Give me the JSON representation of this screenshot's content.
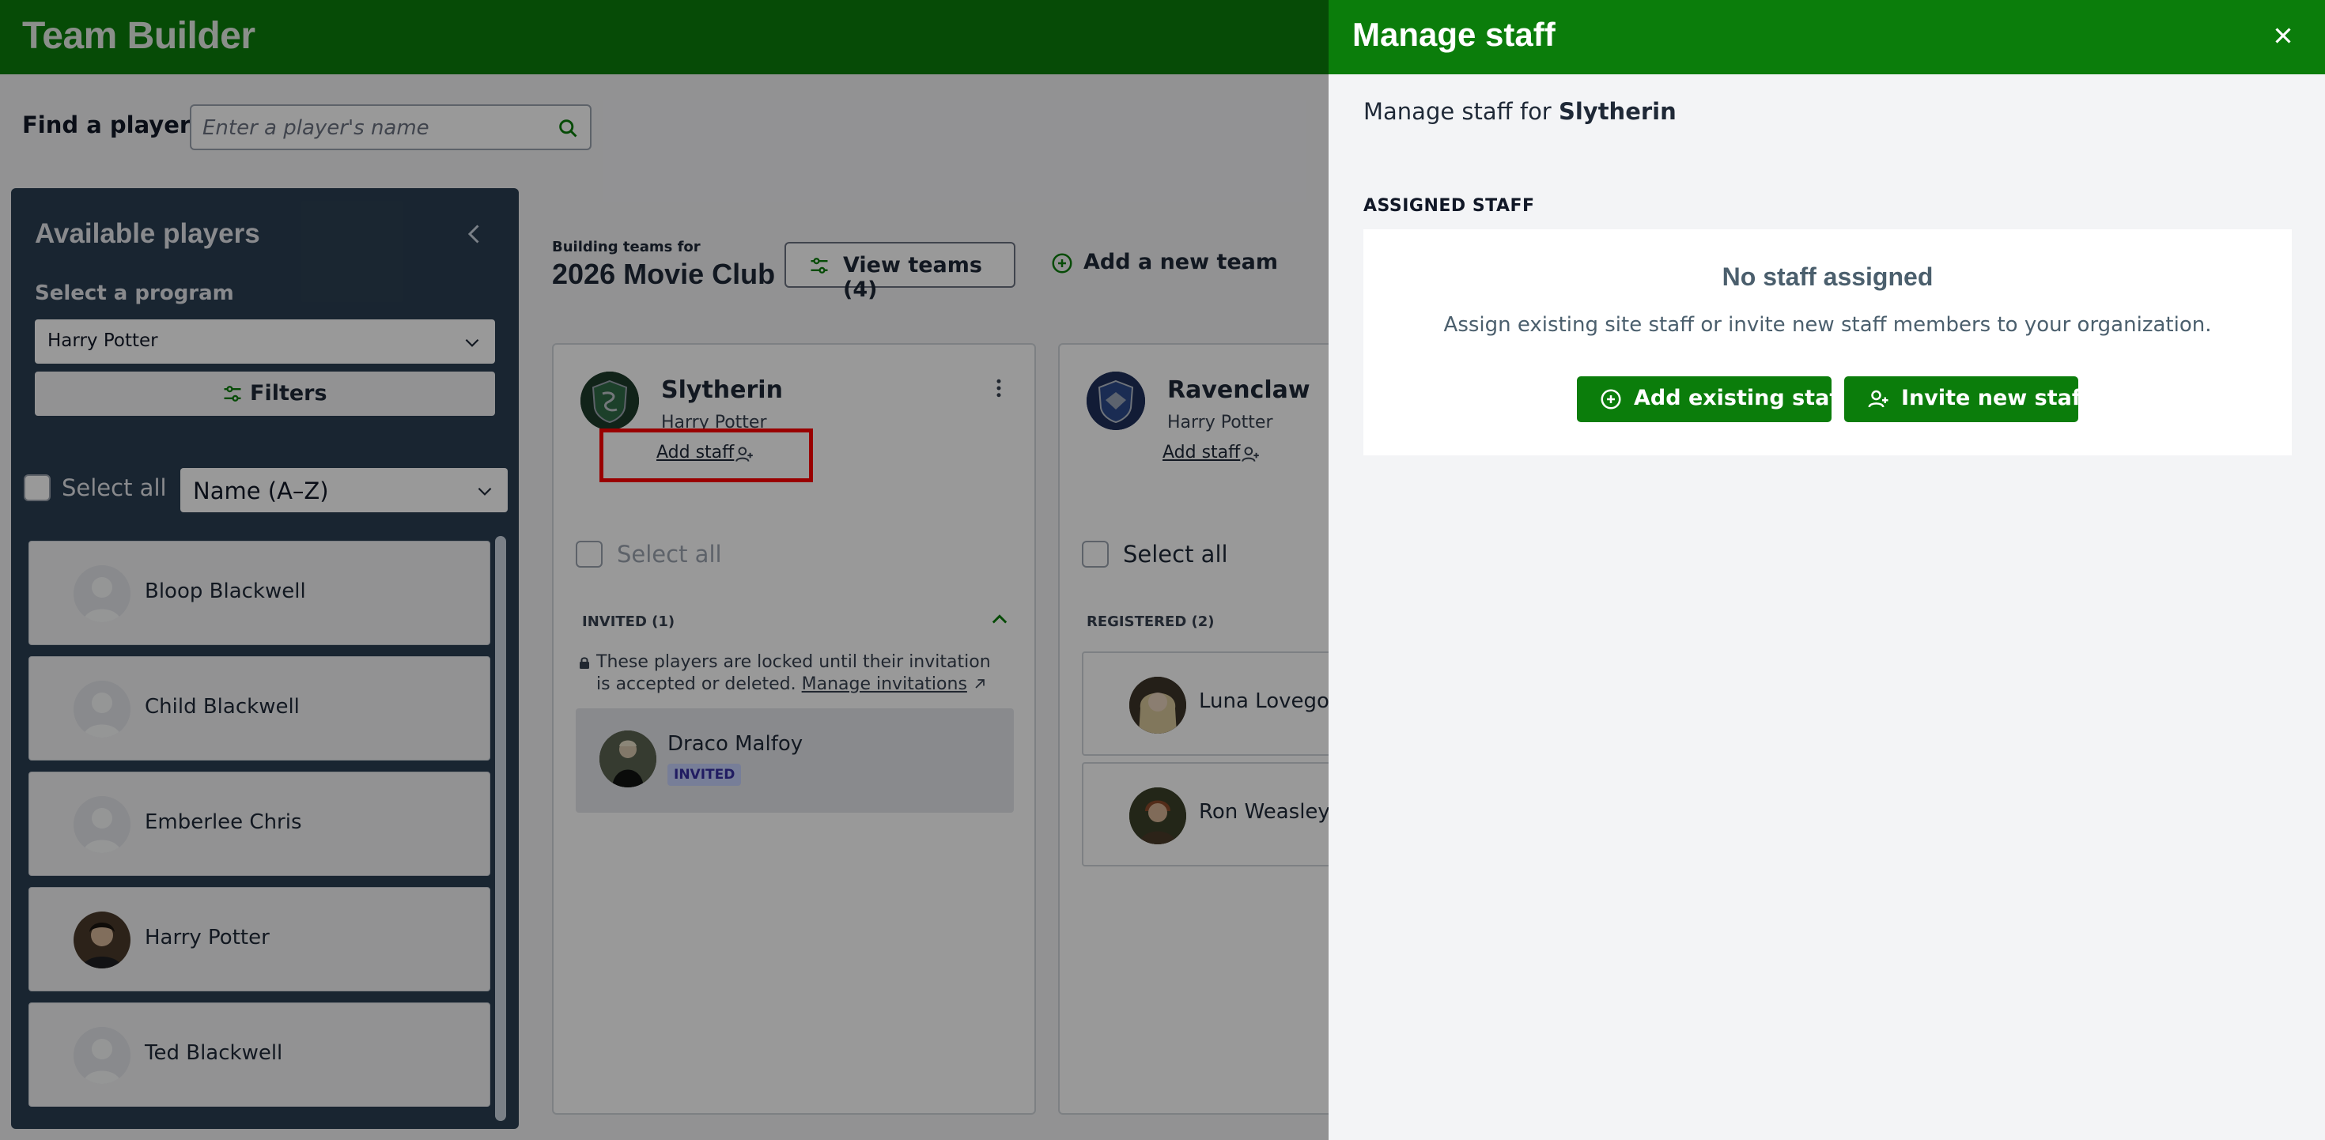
{
  "app": {
    "title": "Team Builder"
  },
  "search": {
    "label": "Find a player",
    "placeholder": "Enter a player's name",
    "value": ""
  },
  "sidebar": {
    "title": "Available players",
    "program_label": "Select a program",
    "program_value": "Harry Potter",
    "filters_label": "Filters",
    "select_all_label": "Select all",
    "sort_value": "Name (A–Z)",
    "players": [
      {
        "name": "Bloop Blackwell",
        "photo": false
      },
      {
        "name": "Child Blackwell",
        "photo": false
      },
      {
        "name": "Emberlee Chris",
        "photo": false
      },
      {
        "name": "Harry Potter",
        "photo": true
      },
      {
        "name": "Ted Blackwell",
        "photo": false
      }
    ]
  },
  "main": {
    "building_label": "Building teams for",
    "club_name": "2026 Movie Club",
    "view_teams_label": "View teams (4)",
    "add_team_label": "Add a new team",
    "teams": [
      {
        "name": "Slytherin",
        "program": "Harry Potter",
        "add_staff_label": "Add staff",
        "select_all_label": "Select all",
        "section_label": "INVITED (1)",
        "lock_note": "These players are locked until their invitation is accepted or deleted.",
        "manage_invitations_label": "Manage invitations",
        "players": [
          {
            "name": "Draco Malfoy",
            "badge": "INVITED"
          }
        ]
      },
      {
        "name": "Ravenclaw",
        "program": "Harry Potter",
        "add_staff_label": "Add staff",
        "select_all_label": "Select all",
        "section_label": "REGISTERED (2)",
        "players": [
          {
            "name": "Luna Lovegood"
          },
          {
            "name": "Ron Weasley"
          }
        ]
      }
    ]
  },
  "drawer": {
    "title": "Manage staff",
    "subtitle_prefix": "Manage staff for",
    "team_name": "Slytherin",
    "assigned_label": "ASSIGNED STAFF",
    "empty_title": "No staff assigned",
    "empty_desc": "Assign existing site staff or invite new staff members to your organization.",
    "add_existing_label": "Add existing staff",
    "invite_new_label": "Invite new staff"
  },
  "colors": {
    "brand_green": "#0b7d0b",
    "sidebar_bg": "#2b3f52",
    "highlight": "#ff0000"
  },
  "icons": [
    "search-icon",
    "chevron-left-icon",
    "chevron-down-icon",
    "sliders-icon",
    "plus-circle-icon",
    "user-plus-icon",
    "kebab-icon",
    "chevron-up-icon",
    "lock-icon",
    "external-link-icon",
    "close-icon"
  ]
}
